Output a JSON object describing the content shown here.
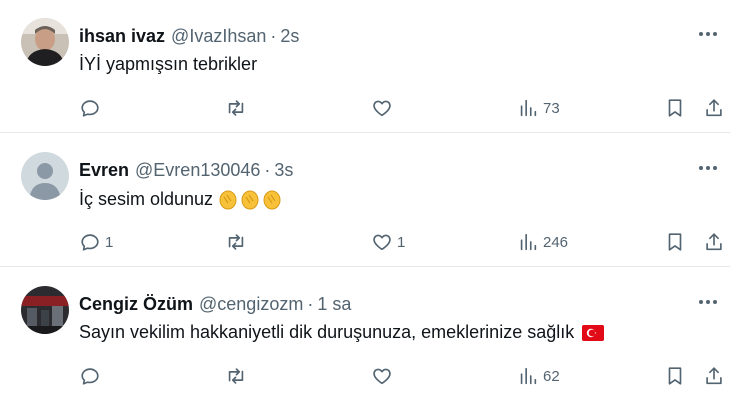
{
  "tweets": [
    {
      "name": "ihsan ivaz",
      "handle": "@IvazIhsan",
      "separator": "·",
      "time": "2s",
      "text": "İYİ  yapmışsın tebrikler",
      "replies": "",
      "retweets": "",
      "likes": "",
      "views": "73",
      "avatar": "photo-avatar"
    },
    {
      "name": "Evren",
      "handle": "@Evren130046",
      "separator": "·",
      "time": "3s",
      "text": "İç sesim oldunuz",
      "emoji": "clapping-hands-emoji ×3",
      "replies": "1",
      "retweets": "",
      "likes": "1",
      "views": "246",
      "avatar": "default-avatar"
    },
    {
      "name": "Cengiz Özüm",
      "handle": "@cengizozm",
      "separator": "·",
      "time": "1 sa",
      "text": "Sayın vekilim hakkaniyetli dik duruşunuza, emeklerinize sağlık",
      "emoji": "turkey-flag-emoji",
      "replies": "",
      "retweets": "",
      "likes": "",
      "views": "62",
      "avatar": "photo-avatar"
    }
  ],
  "colors": {
    "text": "#0f1419",
    "secondary": "#536471",
    "divider": "#e6e9eb",
    "flag": "#e30a17"
  }
}
